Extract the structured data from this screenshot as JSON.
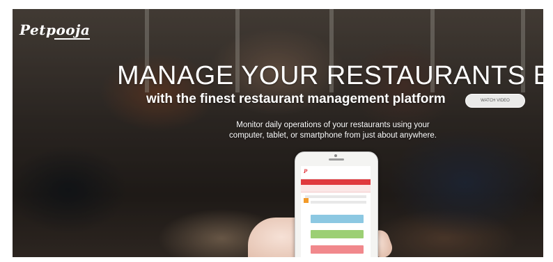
{
  "brand": {
    "logo_text": "Petpooja"
  },
  "hero": {
    "headline": "MANAGE YOUR RESTAURANTS BETTER",
    "subheadline": "with the finest restaurant management platform",
    "cta_label": "WATCH VIDEO",
    "description_line1": "Monitor daily operations of your restaurants using your",
    "description_line2": "computer, tablet, or smartphone from just about anywhere."
  },
  "phone_app": {
    "tiles": [
      {
        "color": "#8cc8e2"
      },
      {
        "color": "#9ccf74"
      },
      {
        "color": "#f1888c"
      }
    ]
  },
  "colors": {
    "brand_red": "#e0393e",
    "accent_orange": "#f39b2a"
  }
}
